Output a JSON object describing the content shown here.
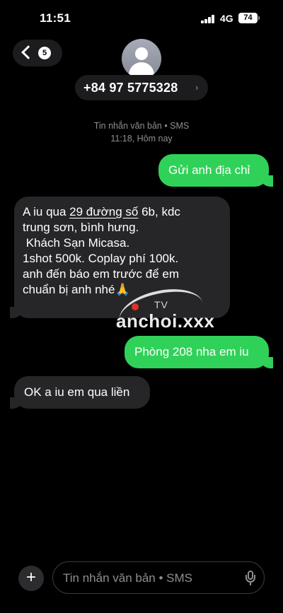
{
  "status": {
    "time": "11:51",
    "network": "4G",
    "battery": "74"
  },
  "header": {
    "unread_count": "5",
    "contact_number": "+84 97 5775328",
    "chevron": "›"
  },
  "thread": {
    "service": "Tin nhắn văn bản • SMS",
    "timestamp": "11:18, Hôm nay"
  },
  "messages": [
    {
      "from": "me",
      "lines": [
        "Gửi anh địa chỉ"
      ]
    },
    {
      "from": "contact",
      "lines": [
        "A iu qua 29 đường số 6b, kdc",
        "trung sơn, bình hưng.",
        " Khách Sạn Micasa.",
        "1shot 500k. Coplay phí 100k.",
        "anh đến báo em trước để em",
        "chuẩn bị anh nhé🙏"
      ]
    },
    {
      "from": "me",
      "lines": [
        "Phòng 208 nha em iu"
      ]
    },
    {
      "from": "contact",
      "lines": [
        "OK a iu em qua liền"
      ]
    }
  ],
  "message_parts": {
    "m2_line1_pre": "A iu qua ",
    "m2_line1_link": "29 đường số",
    "m2_line1_post": " 6b, kdc"
  },
  "watermark": {
    "small": "TV",
    "text": "anchoi.xxx"
  },
  "composer": {
    "plus": "+",
    "placeholder": "Tin nhắn văn bản • SMS"
  },
  "icons": {
    "back": "chevron-left-icon",
    "avatar": "person-icon",
    "mic": "mic-icon",
    "plus": "plus-icon"
  },
  "colors": {
    "outgoing": "#30d158",
    "incoming": "#262628",
    "background": "#000000"
  }
}
